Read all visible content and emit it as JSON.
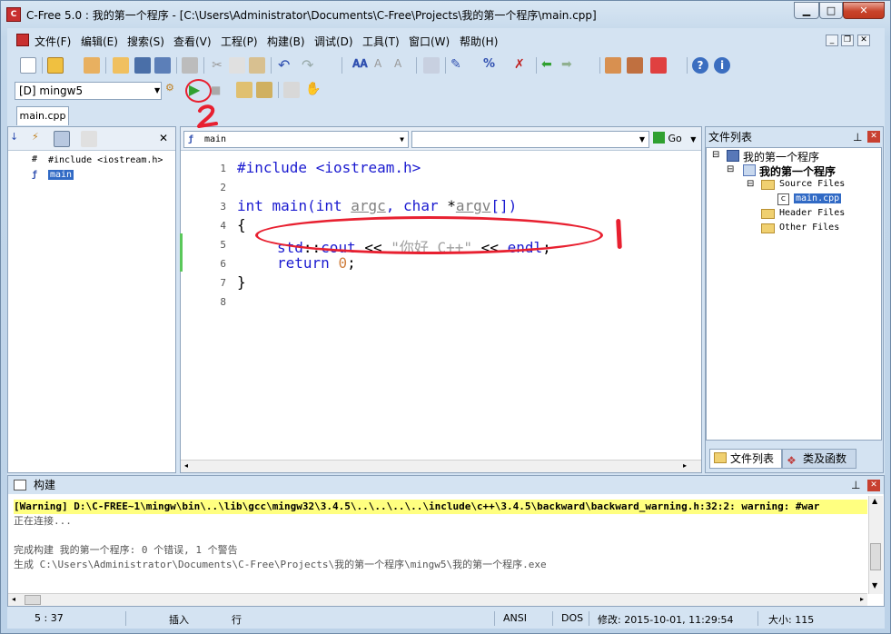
{
  "window": {
    "title": "C-Free 5.0 : 我的第一个程序 - [C:\\Users\\Administrator\\Documents\\C-Free\\Projects\\我的第一个程序\\main.cpp]",
    "app_icon": "C"
  },
  "menu": [
    "文件(F)",
    "编辑(E)",
    "搜索(S)",
    "查看(V)",
    "工程(P)",
    "构建(B)",
    "调试(D)",
    "工具(T)",
    "窗口(W)",
    "帮助(H)"
  ],
  "compiler": {
    "selected": "[D] mingw5"
  },
  "tabs": [
    "main.cpp"
  ],
  "left_pane": {
    "tree": [
      "#include <iostream.h>",
      "main"
    ]
  },
  "editor": {
    "function_combo": "main",
    "go_label": "Go",
    "line_numbers": [
      "1",
      "2",
      "3",
      "4",
      "5",
      "6",
      "7",
      "8"
    ],
    "lines": {
      "l1": "#include <iostream.h>",
      "l3_kw1": "int",
      "l3_fn": " main(",
      "l3_kw2": "int",
      "l3_p1": "argc",
      "l3_sep": ", ",
      "l3_kw3": "char",
      "l3_star": " *",
      "l3_p2": "argv",
      "l3_end": "[])",
      "l4": "{",
      "l5_std": "std",
      "l5_cc": "::",
      "l5_cout": "cout",
      "l5_op1": " << ",
      "l5_str": "\"你好 C++\"",
      "l5_op2": " << ",
      "l5_endl": "endl",
      "l5_semi": ";",
      "l6_kw": "return",
      "l6_num": "0",
      "l6_semi": ";",
      "l7": "}"
    }
  },
  "right_pane": {
    "header": "文件列表",
    "tree": {
      "root": "我的第一个程序",
      "project": "我的第一个程序",
      "source": "Source Files",
      "file": "main.cpp",
      "header": "Header Files",
      "other": "Other Files"
    },
    "tabs": [
      "文件列表",
      "类及函数"
    ]
  },
  "build": {
    "header": "构建",
    "lines": [
      "[Warning] D:\\C-FREE~1\\mingw\\bin\\..\\lib\\gcc\\mingw32\\3.4.5\\..\\..\\..\\..\\include\\c++\\3.4.5\\backward\\backward_warning.h:32:2: warning: #war",
      "正在连接...",
      "",
      "完成构建 我的第一个程序: 0 个错误, 1 个警告",
      "生成 C:\\Users\\Administrator\\Documents\\C-Free\\Projects\\我的第一个程序\\mingw5\\我的第一个程序.exe"
    ]
  },
  "status": {
    "position": "5 : 37",
    "mode": "插入",
    "unit": "行",
    "encoding": "ANSI",
    "line_ending": "DOS",
    "modified": "修改: 2015-10-01, 11:29:54",
    "size": "大小: 115"
  },
  "colors": {
    "annotation_red": "#e82030",
    "keyword_blue": "#1b1bd0",
    "warning_bg": "#ffff80"
  }
}
